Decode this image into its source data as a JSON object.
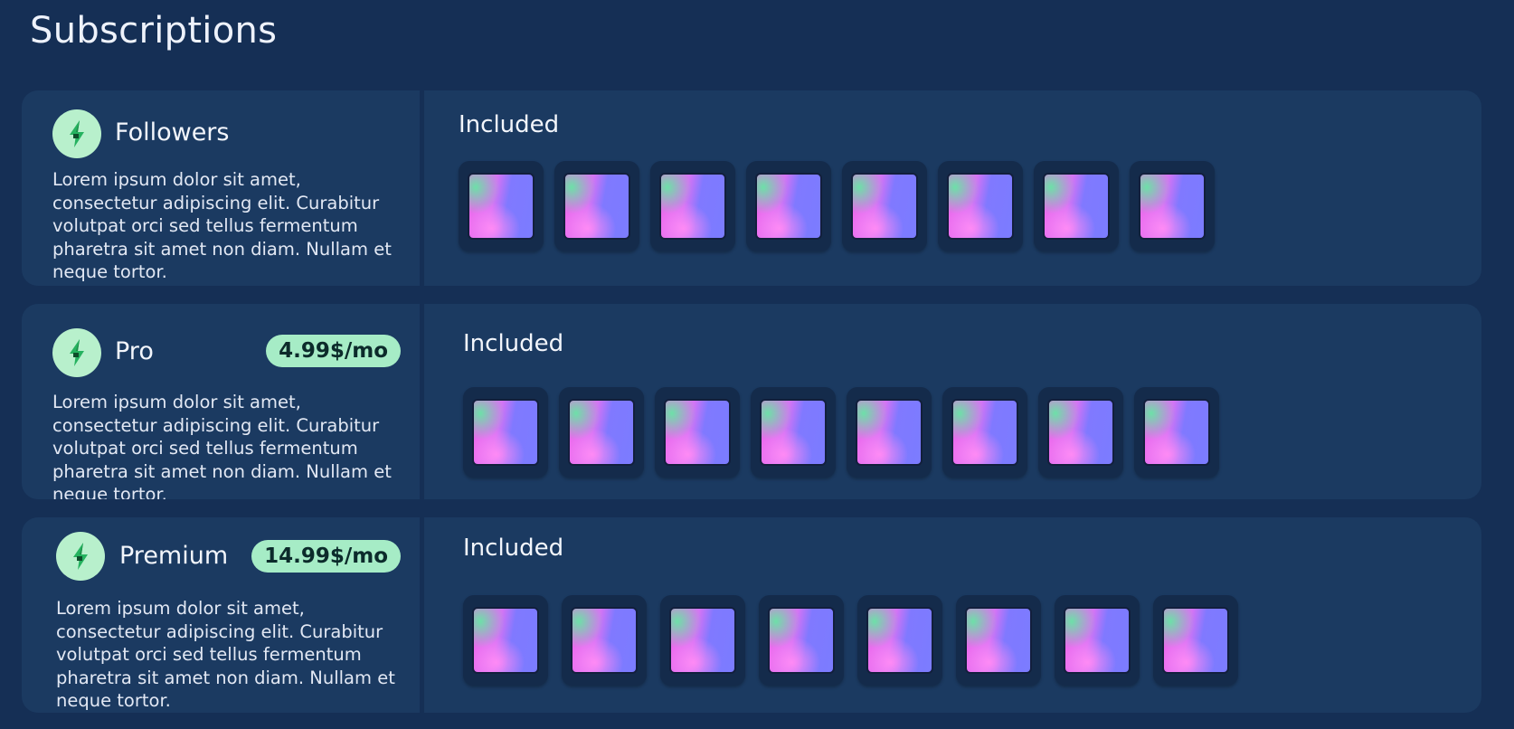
{
  "page": {
    "title": "Subscriptions"
  },
  "tiers": [
    {
      "name": "Followers",
      "price": "",
      "icon": "lightning-icon",
      "description": "Lorem ipsum dolor sit amet, consectetur adipiscing elit. Curabitur volutpat orci sed tellus fermentum pharetra sit amet non diam. Nullam et neque tortor.",
      "included_label": "Included",
      "included_count": 8
    },
    {
      "name": "Pro",
      "price": "4.99$/mo",
      "icon": "lightning-icon",
      "description": "Lorem ipsum dolor sit amet, consectetur adipiscing elit. Curabitur volutpat orci sed tellus fermentum pharetra sit amet non diam. Nullam et neque tortor.",
      "included_label": "Included",
      "included_count": 8
    },
    {
      "name": "Premium",
      "price": "14.99$/mo",
      "icon": "lightning-icon",
      "description": "Lorem ipsum dolor sit amet, consectetur adipiscing elit. Curabitur volutpat orci sed tellus fermentum pharetra sit amet non diam. Nullam et neque tortor.",
      "included_label": "Included",
      "included_count": 8
    }
  ],
  "colors": {
    "background": "#152f55",
    "card": "#1b3a61",
    "badge": "#a6ecc6",
    "icon_bg": "#b8f0cc"
  }
}
